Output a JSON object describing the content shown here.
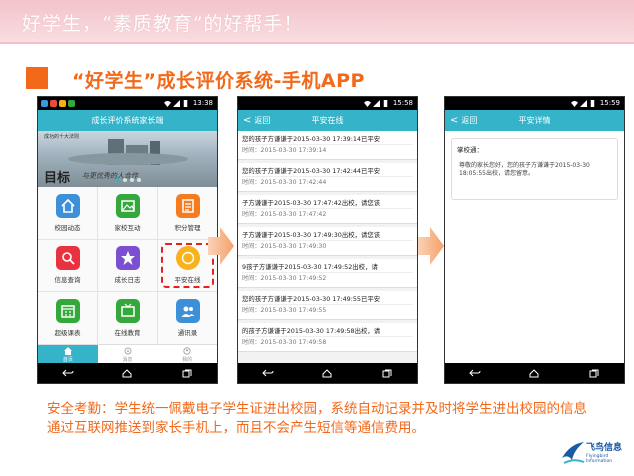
{
  "slide": {
    "slogan": "好学生，“素质教育”的好帮手！",
    "title": "“好学生”成长评价系统-手机APP",
    "description": "安全考勤：学生统一佩戴电子学生证进出校园，系统自动记录并及时将学生进出校园的信息通过互联网推送到家长手机上，而且不会产生短信等通信费用。",
    "logo": {
      "name": "飞鸟信息",
      "sub": "Flyingbird Information"
    }
  },
  "phone1": {
    "status_time": "13:38",
    "title": "成长评价系统家长端",
    "banner": {
      "tag": "成功的十大法则",
      "big_text": "目标",
      "small_text": "与更优秀的人合作"
    },
    "grid": [
      {
        "label": "校园动态",
        "icon": "house-icon",
        "color": "#3d8fd8"
      },
      {
        "label": "家校互动",
        "icon": "picture-icon",
        "color": "#35a83b"
      },
      {
        "label": "积分管理",
        "icon": "clipboard-icon",
        "color": "#f47b20"
      },
      {
        "label": "信息查询",
        "icon": "magnifier-icon",
        "color": "#e8323f"
      },
      {
        "label": "成长日志",
        "icon": "star-icon",
        "color": "#7b4fd1"
      },
      {
        "label": "平安在线",
        "icon": "compass-icon",
        "color": "#f7b21c"
      },
      {
        "label": "超级课表",
        "icon": "calendar-icon",
        "color": "#35a83b"
      },
      {
        "label": "在线教育",
        "icon": "tv-icon",
        "color": "#35a83b"
      },
      {
        "label": "通讯录",
        "icon": "contacts-icon",
        "color": "#3d8fd8"
      }
    ],
    "tabs": [
      {
        "label": "首页",
        "active": true
      },
      {
        "label": "消息",
        "active": false
      },
      {
        "label": "我的",
        "active": false
      }
    ]
  },
  "phone2": {
    "status_time": "15:58",
    "back_label": "返回",
    "title": "平安在线",
    "items": [
      {
        "msg": "您的孩子方谦谦于2015-03-30 17:39:14已平安",
        "time": "时间：2015-03-30 17:39:14"
      },
      {
        "msg": "您的孩子方谦谦于2015-03-30 17:42:44已平安",
        "time": "时间：2015-03-30 17:42:44"
      },
      {
        "msg": "子方谦谦于2015-03-30 17:47:42出校，请您该",
        "time": "时间：2015-03-30 17:47:42"
      },
      {
        "msg": "子方谦谦于2015-03-30 17:49:30出校，请您该",
        "time": "时间：2015-03-30 17:49:30"
      },
      {
        "msg": "9孩子方谦谦于2015-03-30 17:49:52出校，请",
        "time": "时间：2015-03-30 17:49:52"
      },
      {
        "msg": "您的孩子方谦谦于2015-03-30 17:49:55已平安",
        "time": "时间：2015-03-30 17:49:55"
      },
      {
        "msg": "的孩子方谦谦于2015-03-30 17:49:58出校，请",
        "time": "时间：2015-03-30 17:49:58"
      }
    ]
  },
  "phone3": {
    "status_time": "15:59",
    "back_label": "返回",
    "title": "平安详情",
    "card": {
      "recipient": "掌校通：",
      "body": "尊敬的家长您好，您的孩子方谦谦于2015-03-30 18:05:55出校，请您留意。"
    }
  },
  "colors": {
    "accent": "#f2691a",
    "app_header": "#35b3c9",
    "highlight": "#e62020"
  }
}
